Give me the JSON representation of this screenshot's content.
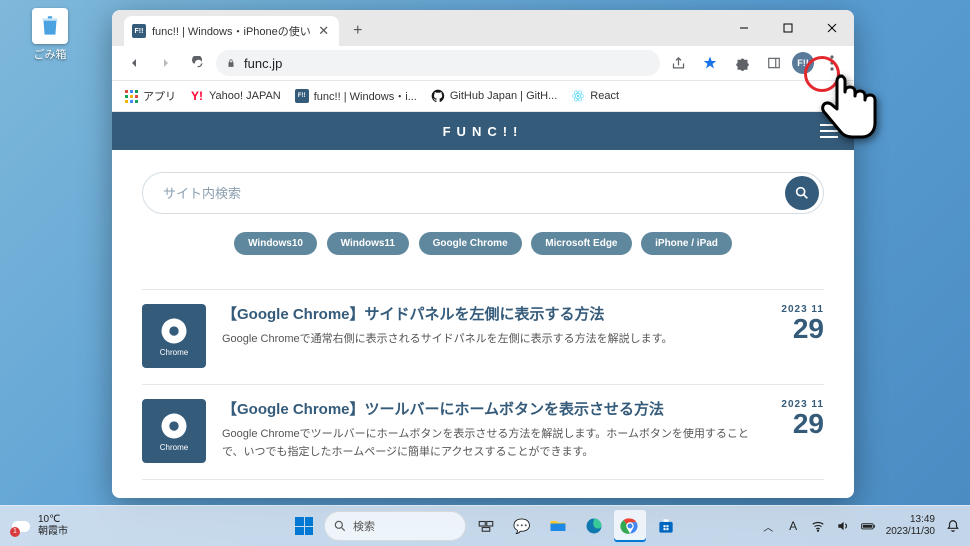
{
  "desktop": {
    "recycle_bin": "ごみ箱"
  },
  "window": {
    "minimize": "−",
    "maximize": "□",
    "close": "✕"
  },
  "tab": {
    "title": "func!! | Windows・iPhoneの使い",
    "favicon": "F!!"
  },
  "url": "func.jp",
  "bookmarks": [
    {
      "icon": "apps",
      "label": "アプリ"
    },
    {
      "icon": "yahoo",
      "label": "Yahoo! JAPAN"
    },
    {
      "icon": "func",
      "label": "func!! | Windows・i..."
    },
    {
      "icon": "github",
      "label": "GitHub Japan | GitH..."
    },
    {
      "icon": "react",
      "label": "React"
    }
  ],
  "site": {
    "name": "FUNC!!",
    "search_placeholder": "サイト内検索",
    "pills": [
      "Windows10",
      "Windows11",
      "Google Chrome",
      "Microsoft Edge",
      "iPhone / iPad"
    ],
    "articles": [
      {
        "thumb_label": "Chrome",
        "title": "【Google Chrome】サイドパネルを左側に表示する方法",
        "desc": "Google Chromeで通常右側に表示されるサイドパネルを左側に表示する方法を解説します。",
        "year_month": "2023 11",
        "day": "29"
      },
      {
        "thumb_label": "Chrome",
        "title": "【Google Chrome】ツールバーにホームボタンを表示させる方法",
        "desc": "Google Chromeでツールバーにホームボタンを表示させる方法を解説します。ホームボタンを使用することで、いつでも指定したホームページに簡単にアクセスすることができます。",
        "year_month": "2023 11",
        "day": "29"
      }
    ]
  },
  "taskbar": {
    "weather": {
      "temp": "10℃",
      "city": "朝霞市",
      "badge": "1"
    },
    "search": "検索",
    "ime": "A",
    "clock": {
      "time": "13:49",
      "date": "2023/11/30"
    }
  }
}
